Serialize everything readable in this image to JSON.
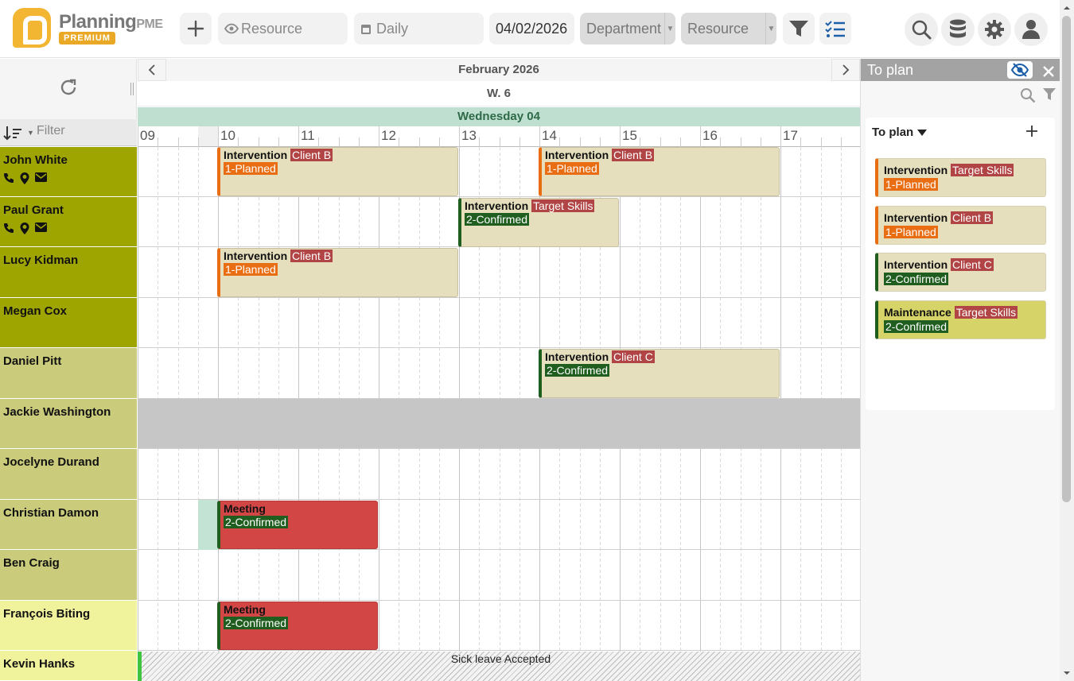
{
  "toolbar": {
    "logo_text": "Planning",
    "logo_text_suffix": "PME",
    "logo_badge": "PREMIUM",
    "resource_placeholder": "Resource",
    "view_label": "Daily",
    "date_value": "04/02/2026",
    "department_select": "Department",
    "resource_select": "Resource"
  },
  "calendar": {
    "month": "February 2026",
    "week": "W. 6",
    "day": "Wednesday 04",
    "hours": [
      "09",
      "10",
      "11",
      "12",
      "13",
      "14",
      "15",
      "16",
      "17"
    ]
  },
  "left": {
    "filter_placeholder": "Filter"
  },
  "resources": [
    {
      "name": "John White"
    },
    {
      "name": "Paul Grant"
    },
    {
      "name": "Lucy Kidman"
    },
    {
      "name": "Megan Cox"
    },
    {
      "name": "Daniel Pitt"
    },
    {
      "name": "Jackie Washington"
    },
    {
      "name": "Jocelyne Durand"
    },
    {
      "name": "Christian Damon"
    },
    {
      "name": "Ben Craig"
    },
    {
      "name": "François Biting"
    },
    {
      "name": "Kevin Hanks"
    }
  ],
  "events": [
    {
      "title": "Intervention",
      "client": "Client B",
      "status": "1-Planned"
    },
    {
      "title": "Intervention",
      "client": "Client B",
      "status": "1-Planned"
    },
    {
      "title": "Intervention",
      "client": "Target Skills",
      "status": "2-Confirmed"
    },
    {
      "title": "Intervention",
      "client": "Client B",
      "status": "1-Planned"
    },
    {
      "title": "Intervention",
      "client": "Client C",
      "status": "2-Confirmed"
    },
    {
      "title": "Meeting",
      "status": "2-Confirmed"
    },
    {
      "title": "Meeting",
      "status": "2-Confirmed"
    }
  ],
  "absence": {
    "label": "Sick leave Accepted"
  },
  "panel": {
    "title": "To plan",
    "section_label": "To plan",
    "items": [
      {
        "title": "Intervention",
        "client": "Target Skills",
        "status": "1-Planned"
      },
      {
        "title": "Intervention",
        "client": "Client B",
        "status": "1-Planned"
      },
      {
        "title": "Intervention",
        "client": "Client C",
        "status": "2-Confirmed"
      },
      {
        "title": "Maintenance",
        "client": "Target Skills",
        "status": "2-Confirmed"
      }
    ]
  },
  "colors": {
    "resource_dark": "#9ea500",
    "resource_mid": "#cacc7b",
    "resource_light": "#f0f29c",
    "event_bg": "#e6dfbd",
    "meeting_bg": "#d24646",
    "planned": "#e96d12",
    "confirmed": "#1f5e1f"
  }
}
